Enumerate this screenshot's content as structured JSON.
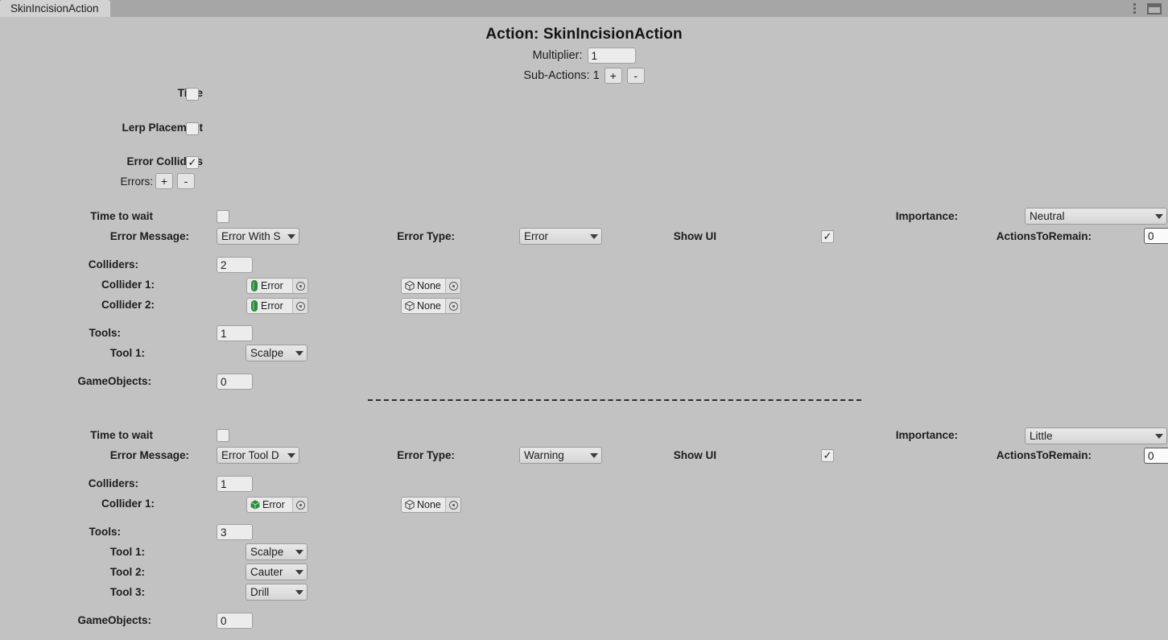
{
  "window": {
    "tab_label": "SkinIncisionAction",
    "menu_icon": "kebab-menu-icon",
    "panel_icon": "panel-layout-icon"
  },
  "header": {
    "title": "Action: SkinIncisionAction",
    "multiplier_label": "Multiplier:",
    "multiplier_value": "1",
    "sub_actions_label": "Sub-Actions: 1",
    "add_label": "+",
    "remove_label": "-"
  },
  "top_toggles": {
    "time_label": "Time",
    "time_checked": false,
    "lerp_label": "Lerp Placement",
    "lerp_checked": false,
    "error_colliders_label": "Error Colliders",
    "error_colliders_checked": true,
    "errors_label": "Errors:",
    "errors_add_label": "+",
    "errors_remove_label": "-"
  },
  "labels": {
    "time_to_wait": "Time to wait",
    "error_message": "Error Message:",
    "error_type": "Error Type:",
    "show_ui": "Show UI",
    "importance": "Importance:",
    "actions_to_remain": "ActionsToRemain:",
    "colliders": "Colliders:",
    "tools": "Tools:",
    "game_objects": "GameObjects:"
  },
  "errors": [
    {
      "time_to_wait_checked": false,
      "error_message": "Error With S",
      "error_type": "Error",
      "show_ui_checked": true,
      "importance": "Neutral",
      "actions_to_remain": "0",
      "colliders_count": "2",
      "collider_rows": [
        {
          "label": "Collider 1:",
          "left_icon": "capsule-collider-icon",
          "left_name": "Error",
          "right_icon": "cube-outline-icon",
          "right_name": "None"
        },
        {
          "label": "Collider 2:",
          "left_icon": "capsule-collider-icon",
          "left_name": "Error",
          "right_icon": "cube-outline-icon",
          "right_name": "None"
        }
      ],
      "tools_count": "1",
      "tool_rows": [
        {
          "label": "Tool 1:",
          "value": "Scalpe"
        }
      ],
      "game_objects_count": "0"
    },
    {
      "time_to_wait_checked": false,
      "error_message": "Error Tool D",
      "error_type": "Warning",
      "show_ui_checked": true,
      "importance": "Little",
      "actions_to_remain": "0",
      "colliders_count": "1",
      "collider_rows": [
        {
          "label": "Collider 1:",
          "left_icon": "prefab-cube-icon",
          "left_name": "Error",
          "right_icon": "cube-outline-icon",
          "right_name": "None"
        }
      ],
      "tools_count": "3",
      "tool_rows": [
        {
          "label": "Tool 1:",
          "value": "Scalpe"
        },
        {
          "label": "Tool 2:",
          "value": "Cauter"
        },
        {
          "label": "Tool 3:",
          "value": "Drill"
        }
      ],
      "game_objects_count": "0"
    }
  ],
  "colors": {
    "background": "#c2c2c2",
    "tabbar": "#a6a6a6",
    "tab_active": "#d2d2d2",
    "field": "#ececec",
    "collider_green": "#2f8a3e"
  }
}
